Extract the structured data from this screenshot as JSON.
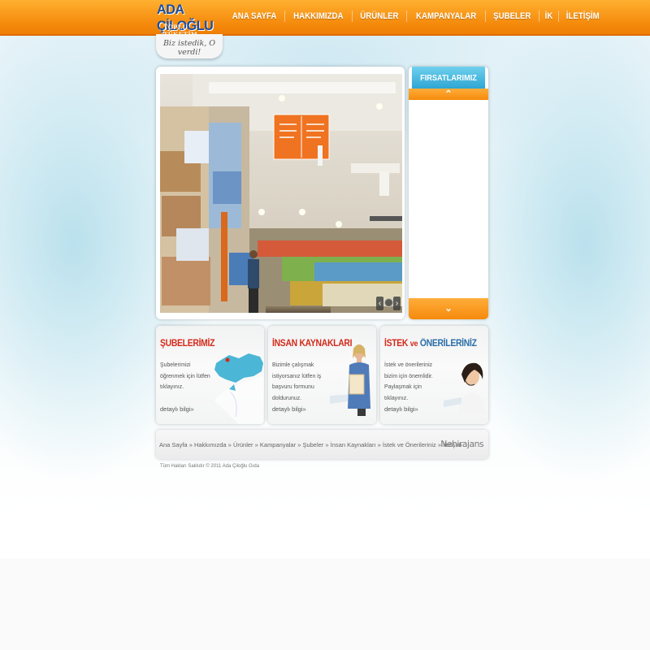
{
  "header": {
    "logo_main": "ADA ÇİLOĞLU",
    "logo_sub": "TOPLU TÜKETİM",
    "slogan": "Biz istedik, O verdi!"
  },
  "nav": {
    "items": [
      {
        "label": "ANA SAYFA"
      },
      {
        "label": "HAKKIMIZDA"
      },
      {
        "label": "ÜRÜNLER"
      },
      {
        "label": "KAMPANYALAR"
      },
      {
        "label": "ŞUBELER"
      },
      {
        "label": "İK"
      },
      {
        "label": "İLETİŞİM"
      }
    ]
  },
  "deals": {
    "title": "FIRSATLARIMIZ",
    "up_icon": "chevron-up-icon",
    "down_icon": "chevron-down-icon"
  },
  "boxes": [
    {
      "title": "ŞUBELERİMİZ",
      "text": "Şubelerimizi öğrenmek için lütfen tıklayınız.",
      "link": "detaylı bilgi»",
      "image": "turkey-map"
    },
    {
      "title": "İNSAN KAYNAKLARI",
      "text": "Bizimle çalışmak istiyorsanız lütfen iş başvuru formunu doldurunuz.",
      "link": "detaylı bilgi»",
      "image": "woman-with-folder"
    },
    {
      "title_part1": "İSTEK",
      "title_part2": "ve",
      "title_part3": "ÖNERİLERİNİZ",
      "text": "İstek ve önerileriniz bizim için önemlidir. Paylaşmak için tıklayınız.",
      "link": "detaylı bilgi»",
      "image": "woman-with-headset"
    }
  ],
  "footer": {
    "crumbs": [
      "Ana Sayfa",
      "Hakkımızda",
      "Ürünler",
      "Kampanyalar",
      "Şubeler",
      "İnsan Kaynakları",
      "İstek ve Önerileriniz",
      "İletişim"
    ],
    "separator": "»",
    "agency": "Nehirajans",
    "copyright": "Tüm Hakları Saklıdır © 2011 Ada Çiloğlu Gıda"
  },
  "colors": {
    "header_orange": "#f58a0c",
    "logo_blue": "#1b4e9e",
    "deals_blue": "#2ea6d3",
    "title_red": "#d42a1a"
  }
}
